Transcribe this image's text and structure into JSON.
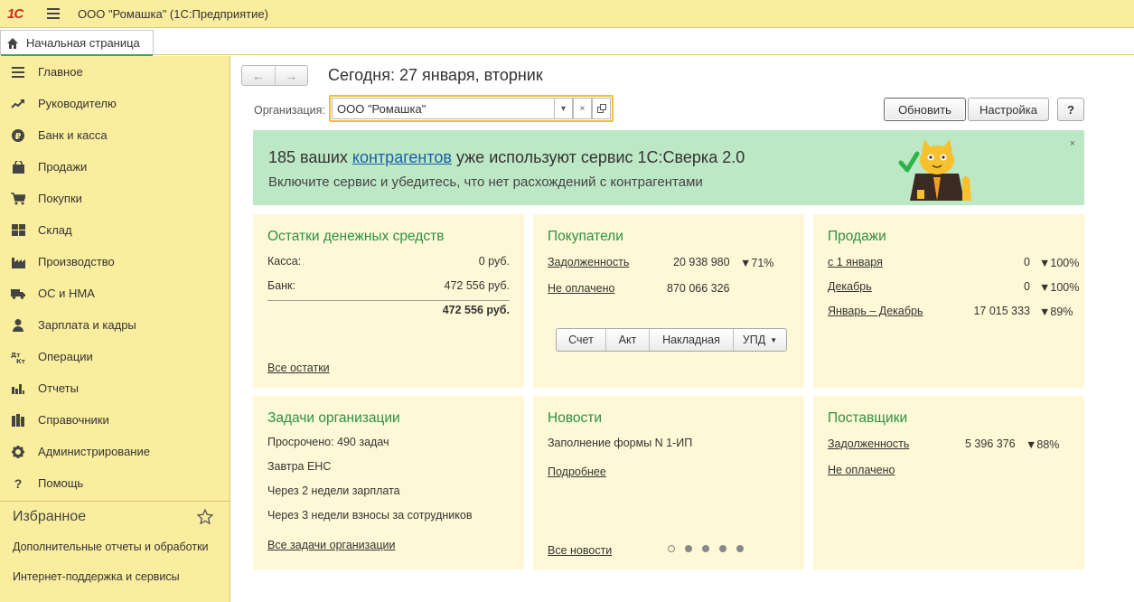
{
  "app": {
    "logo_text": "1С",
    "title": "ООО \"Ромашка\"  (1С:Предприятие)"
  },
  "tabs": {
    "home_label": "Начальная страница"
  },
  "sidebar": {
    "items": [
      {
        "label": "Главное",
        "icon": "menu-lines-icon"
      },
      {
        "label": "Руководителю",
        "icon": "trend-icon"
      },
      {
        "label": "Банк и касса",
        "icon": "ruble-icon"
      },
      {
        "label": "Продажи",
        "icon": "bag-icon"
      },
      {
        "label": "Покупки",
        "icon": "cart-icon"
      },
      {
        "label": "Склад",
        "icon": "warehouse-icon"
      },
      {
        "label": "Производство",
        "icon": "factory-icon"
      },
      {
        "label": "ОС и НМА",
        "icon": "truck-icon"
      },
      {
        "label": "Зарплата и кадры",
        "icon": "person-icon"
      },
      {
        "label": "Операции",
        "icon": "dt-kt-icon"
      },
      {
        "label": "Отчеты",
        "icon": "bar-chart-icon"
      },
      {
        "label": "Справочники",
        "icon": "books-icon"
      },
      {
        "label": "Администрирование",
        "icon": "gear-icon"
      },
      {
        "label": "Помощь",
        "icon": "question-icon"
      }
    ],
    "favorites_title": "Избранное",
    "favorites": [
      "Дополнительные отчеты и обработки",
      "Интернет-поддержка и сервисы"
    ]
  },
  "main": {
    "page_title": "Сегодня: 27 января, вторник",
    "org_label": "Организация:",
    "org_value": "ООО \"Ромашка\"",
    "refresh_button": "Обновить",
    "settings_button": "Настройка",
    "help_button": "?"
  },
  "banner": {
    "line1_prefix": "185 ваших ",
    "line1_link": "контрагентов",
    "line1_suffix": " уже используют сервис 1С:Сверка 2.0",
    "line2": "Включите сервис и убедитесь, что нет расхождений с контрагентами",
    "close": "×"
  },
  "cash": {
    "title": "Остатки денежных средств",
    "rows": [
      {
        "label": "Касса:",
        "value": "0 руб."
      },
      {
        "label": "Банк:",
        "value": "472 556 руб."
      }
    ],
    "total": "472 556 руб.",
    "link": "Все остатки"
  },
  "buyers": {
    "title": "Покупатели",
    "rows": [
      {
        "label": "Задолженность",
        "value": "20 938 980",
        "delta": "▼71%"
      },
      {
        "label": "Не оплачено",
        "value": "870 066 326",
        "delta": ""
      }
    ],
    "buttons": [
      "Счет",
      "Акт",
      "Накладная",
      "УПД"
    ]
  },
  "sales": {
    "title": "Продажи",
    "rows": [
      {
        "label": "с 1 января",
        "value": "0",
        "delta": "▼100%"
      },
      {
        "label": "Декабрь",
        "value": "0",
        "delta": "▼100%"
      },
      {
        "label": "Январь – Декабрь",
        "value": "17 015 333",
        "delta": "▼89%"
      }
    ]
  },
  "tasks": {
    "title": "Задачи организации",
    "overdue": "Просрочено: 490 задач",
    "tomorrow": "Завтра ЕНС",
    "in2weeks": "Через 2 недели зарплата",
    "in3weeks": "Через 3 недели взносы за сотрудников",
    "link": "Все задачи организации"
  },
  "news": {
    "title": "Новости",
    "headline": "Заполнение формы N 1-ИП",
    "more": "Подробнее",
    "all": "Все новости",
    "pages": 5,
    "current_page": 1
  },
  "suppliers": {
    "title": "Поставщики",
    "rows": [
      {
        "label": "Задолженность",
        "value": "5 396 376",
        "delta": "▼88%"
      },
      {
        "label": "Не оплачено",
        "value": "",
        "delta": ""
      }
    ]
  },
  "colors": {
    "sidebar_bg": "#fbed9e",
    "card_bg": "#fef8d6",
    "banner_bg": "#bde8c5",
    "title_green": "#2b9142",
    "link_blue": "#1b5fa8",
    "decline_red": "#d9261c"
  }
}
